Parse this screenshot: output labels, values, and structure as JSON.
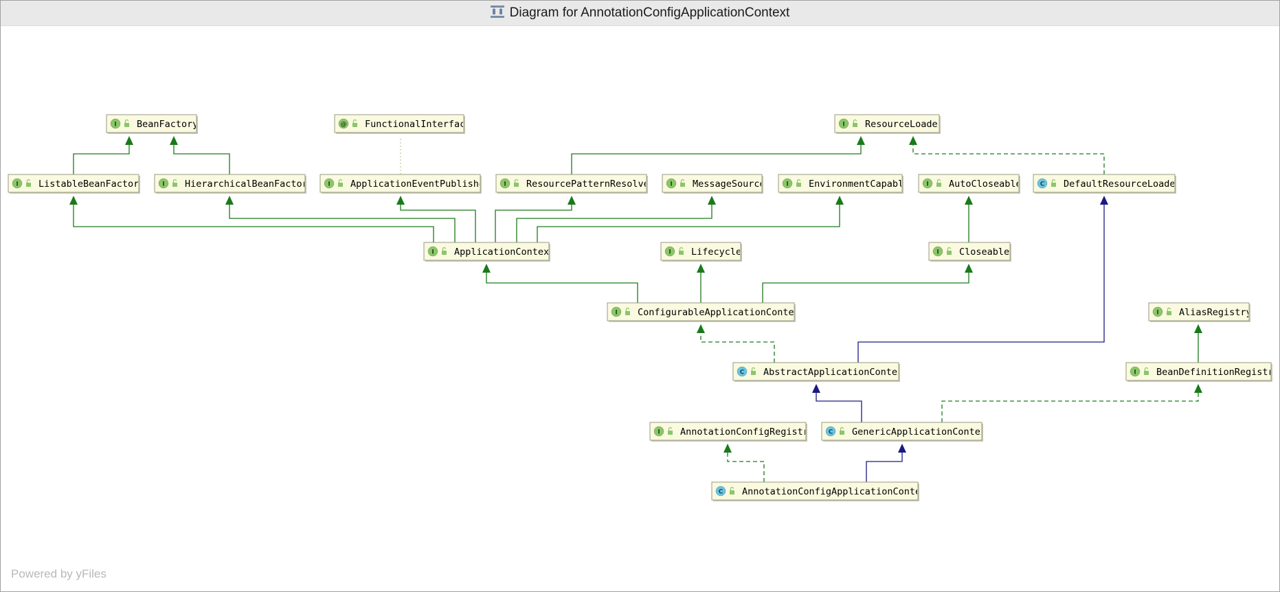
{
  "window": {
    "title": "Diagram for AnnotationConfigApplicationContext",
    "title_icon": "diagram-icon"
  },
  "footer": {
    "text": "Powered by yFiles"
  },
  "colors": {
    "node_fill": "#fafae0",
    "interface_badge": "#8cc56b",
    "class_badge": "#6fc3dc",
    "extends_edge": "#1a1a80",
    "implements_edge": "#1a7a1a"
  },
  "nodes": [
    {
      "id": "BeanFactory",
      "label": "BeanFactory",
      "kind": "I"
    },
    {
      "id": "FunctionalInterface",
      "label": "FunctionalInterfac",
      "kind": "@"
    },
    {
      "id": "ResourceLoader",
      "label": "ResourceLoader",
      "kind": "I"
    },
    {
      "id": "ListableBeanFactory",
      "label": "ListableBeanFactor",
      "kind": "I"
    },
    {
      "id": "HierarchicalBeanFactory",
      "label": "HierarchicalBeanFactor",
      "kind": "I"
    },
    {
      "id": "ApplicationEventPublisher",
      "label": "ApplicationEventPublishe",
      "kind": "I"
    },
    {
      "id": "ResourcePatternResolver",
      "label": "ResourcePatternResolve",
      "kind": "I"
    },
    {
      "id": "MessageSource",
      "label": "MessageSource",
      "kind": "I"
    },
    {
      "id": "EnvironmentCapable",
      "label": "EnvironmentCapabl",
      "kind": "I"
    },
    {
      "id": "AutoCloseable",
      "label": "AutoCloseable",
      "kind": "I"
    },
    {
      "id": "DefaultResourceLoader",
      "label": "DefaultResourceLoade",
      "kind": "C"
    },
    {
      "id": "ApplicationContext",
      "label": "ApplicationContex",
      "kind": "I"
    },
    {
      "id": "Lifecycle",
      "label": "Lifecycle",
      "kind": "I"
    },
    {
      "id": "Closeable",
      "label": "Closeable",
      "kind": "I"
    },
    {
      "id": "ConfigurableApplicationContext",
      "label": "ConfigurableApplicationContex",
      "kind": "I"
    },
    {
      "id": "AliasRegistry",
      "label": "AliasRegistry",
      "kind": "I"
    },
    {
      "id": "AbstractApplicationContext",
      "label": "AbstractApplicationContex",
      "kind": "C"
    },
    {
      "id": "BeanDefinitionRegistry",
      "label": "BeanDefinitionRegistr",
      "kind": "I"
    },
    {
      "id": "AnnotationConfigRegistry",
      "label": "AnnotationConfigRegistr",
      "kind": "I"
    },
    {
      "id": "GenericApplicationContext",
      "label": "GenericApplicationContex",
      "kind": "C"
    },
    {
      "id": "AnnotationConfigApplicationContext",
      "label": "AnnotationConfigApplicationConte",
      "kind": "C"
    }
  ],
  "edges": [
    {
      "from": "ListableBeanFactory",
      "to": "BeanFactory",
      "type": "extends-interface"
    },
    {
      "from": "HierarchicalBeanFactory",
      "to": "BeanFactory",
      "type": "extends-interface"
    },
    {
      "from": "ApplicationEventPublisher",
      "to": "FunctionalInterface",
      "type": "annotation"
    },
    {
      "from": "ResourcePatternResolver",
      "to": "ResourceLoader",
      "type": "extends-interface"
    },
    {
      "from": "DefaultResourceLoader",
      "to": "ResourceLoader",
      "type": "implements"
    },
    {
      "from": "ApplicationContext",
      "to": "ListableBeanFactory",
      "type": "extends-interface"
    },
    {
      "from": "ApplicationContext",
      "to": "HierarchicalBeanFactory",
      "type": "extends-interface"
    },
    {
      "from": "ApplicationContext",
      "to": "ApplicationEventPublisher",
      "type": "extends-interface"
    },
    {
      "from": "ApplicationContext",
      "to": "ResourcePatternResolver",
      "type": "extends-interface"
    },
    {
      "from": "ApplicationContext",
      "to": "MessageSource",
      "type": "extends-interface"
    },
    {
      "from": "ApplicationContext",
      "to": "EnvironmentCapable",
      "type": "extends-interface"
    },
    {
      "from": "Closeable",
      "to": "AutoCloseable",
      "type": "extends-interface"
    },
    {
      "from": "ConfigurableApplicationContext",
      "to": "ApplicationContext",
      "type": "extends-interface"
    },
    {
      "from": "ConfigurableApplicationContext",
      "to": "Lifecycle",
      "type": "extends-interface"
    },
    {
      "from": "ConfigurableApplicationContext",
      "to": "Closeable",
      "type": "extends-interface"
    },
    {
      "from": "AbstractApplicationContext",
      "to": "ConfigurableApplicationContext",
      "type": "implements"
    },
    {
      "from": "AbstractApplicationContext",
      "to": "DefaultResourceLoader",
      "type": "extends-class"
    },
    {
      "from": "BeanDefinitionRegistry",
      "to": "AliasRegistry",
      "type": "extends-interface"
    },
    {
      "from": "GenericApplicationContext",
      "to": "AbstractApplicationContext",
      "type": "extends-class"
    },
    {
      "from": "GenericApplicationContext",
      "to": "BeanDefinitionRegistry",
      "type": "implements"
    },
    {
      "from": "AnnotationConfigApplicationContext",
      "to": "AnnotationConfigRegistry",
      "type": "implements"
    },
    {
      "from": "AnnotationConfigApplicationContext",
      "to": "GenericApplicationContext",
      "type": "extends-class"
    }
  ]
}
